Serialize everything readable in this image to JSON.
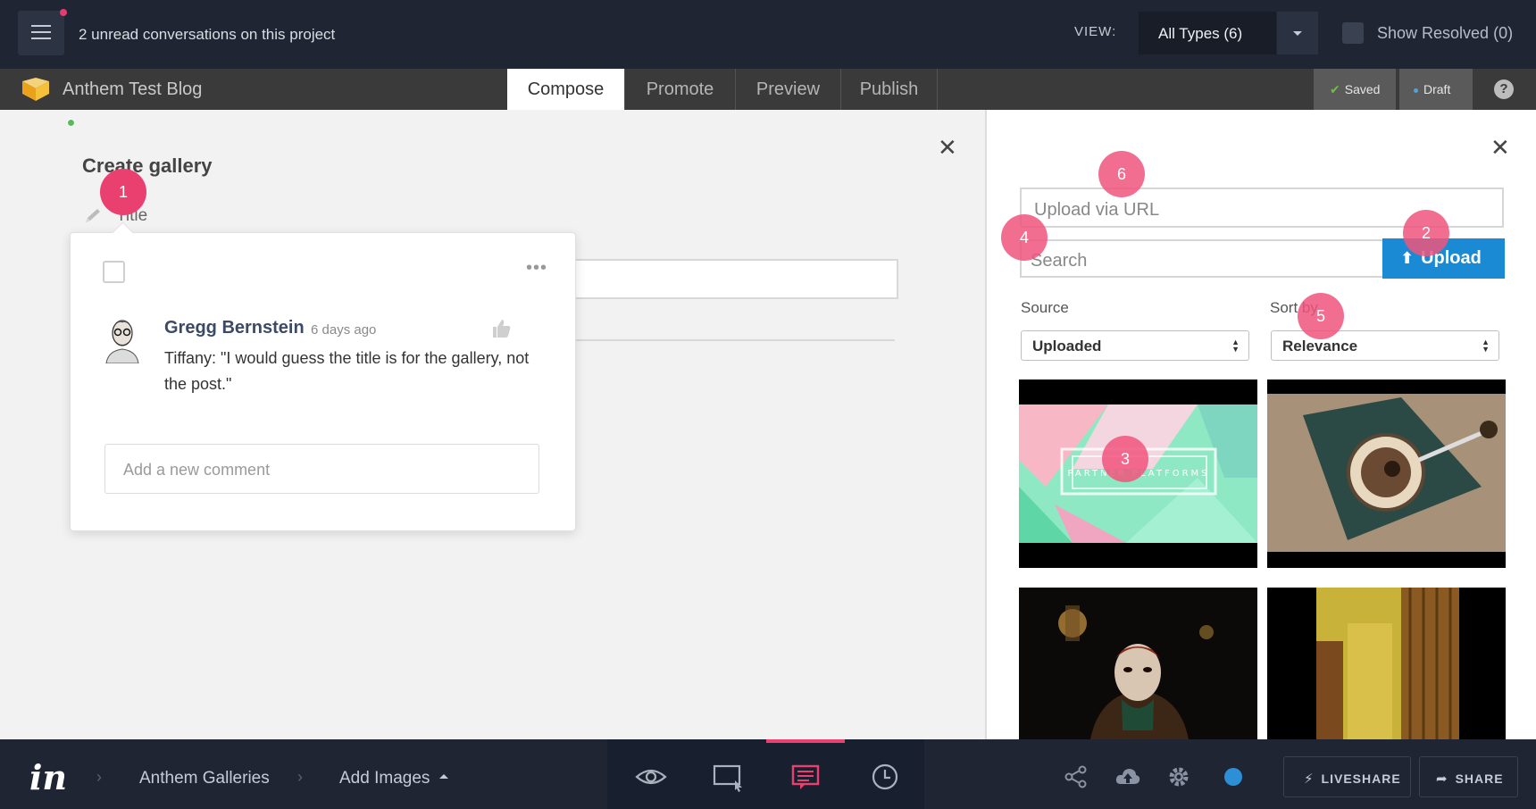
{
  "topbar": {
    "unread_text": "2 unread conversations on this project",
    "view_label": "VIEW:",
    "view_value": "All Types (6)",
    "show_resolved": "Show Resolved (0)"
  },
  "appbar": {
    "blog_name": "Anthem Test Blog",
    "tabs": [
      "Compose",
      "Promote",
      "Preview",
      "Publish"
    ],
    "active_tab": "Compose",
    "saved_label": "Saved",
    "draft_label": "Draft",
    "help_glyph": "?"
  },
  "editor": {
    "heading": "Create gallery",
    "title_label": "Title",
    "close_glyph": "✕"
  },
  "comment": {
    "more_glyph": "•••",
    "author": "Gregg Bernstein",
    "time_ago": "6 days ago",
    "text": "Tiffany: \"I would guess the title is for the gallery, not the post.\"",
    "new_comment_placeholder": "Add a new comment"
  },
  "media": {
    "close_glyph": "✕",
    "url_placeholder": "Upload via URL",
    "search_placeholder": "Search",
    "upload_label": "Upload",
    "source_label": "Source",
    "source_value": "Uploaded",
    "sort_label": "Sort by",
    "sort_value": "Relevance",
    "thumb1_overlay_text": "PARTNER PLATFORMS"
  },
  "hotspots": [
    "1",
    "2",
    "3",
    "4",
    "5",
    "6"
  ],
  "bottombar": {
    "crumbs": [
      "Anthem Galleries",
      "Add Images"
    ],
    "sep_glyph": "›",
    "liveshare_label": "LIVESHARE",
    "share_label": "SHARE",
    "logo_text": "in"
  },
  "colors": {
    "accent_pink": "#e9406f",
    "upload_blue": "#1a8ad4",
    "dark_navy": "#1f2532",
    "online_green": "#5cb85c"
  },
  "icons": [
    "menu-icon",
    "caret-down-icon",
    "pencil-icon",
    "thumbs-up-icon",
    "upload-arrow-icon",
    "eye-icon",
    "screen-cursor-icon",
    "comment-icon",
    "history-icon",
    "share-nodes-icon",
    "cloud-icon",
    "gear-icon",
    "lightning-icon",
    "share-arrow-icon",
    "help-icon",
    "close-icon"
  ]
}
